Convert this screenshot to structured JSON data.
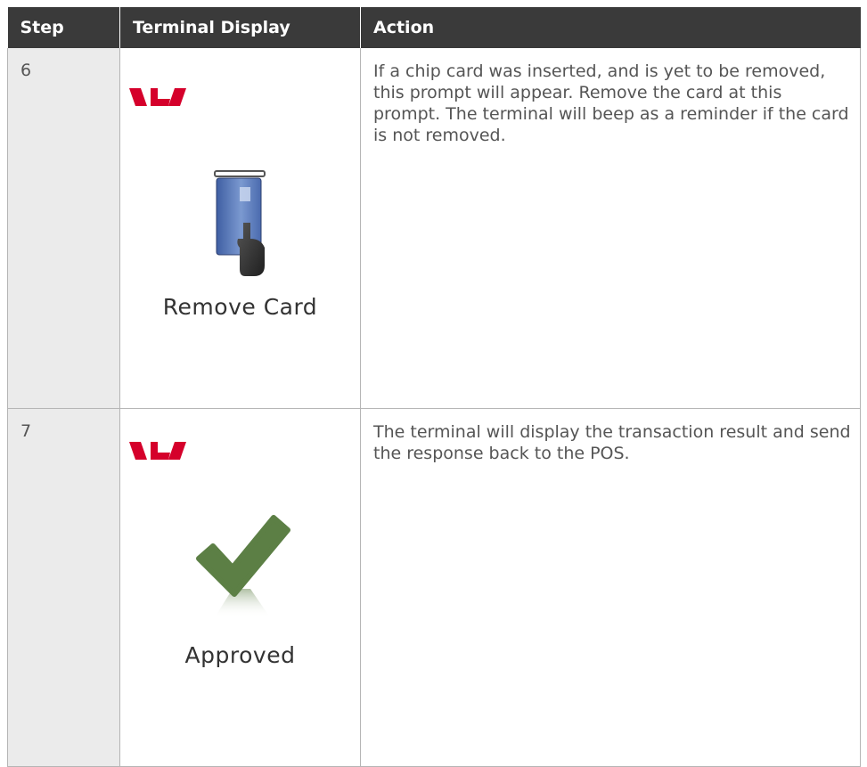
{
  "table": {
    "headers": {
      "step": "Step",
      "terminal_display": "Terminal Display",
      "action": "Action"
    },
    "rows": [
      {
        "step": "6",
        "display_label": "Remove Card",
        "display_icon": "remove-card-icon",
        "action": "If a chip card was inserted, and is yet to be removed, this prompt will appear. Remove the card at this prompt. The terminal will beep as a reminder if the card is not removed."
      },
      {
        "step": "7",
        "display_label": "Approved",
        "display_icon": "approved-checkmark-icon",
        "action": "The terminal will display the transaction result and send the response back to the POS."
      }
    ]
  },
  "colors": {
    "header_bg": "#3a3a3a",
    "step_column_bg": "#ebebeb",
    "brand_red": "#d5002b",
    "check_green": "#5c7f45",
    "card_blue": "#5a7dbd"
  }
}
